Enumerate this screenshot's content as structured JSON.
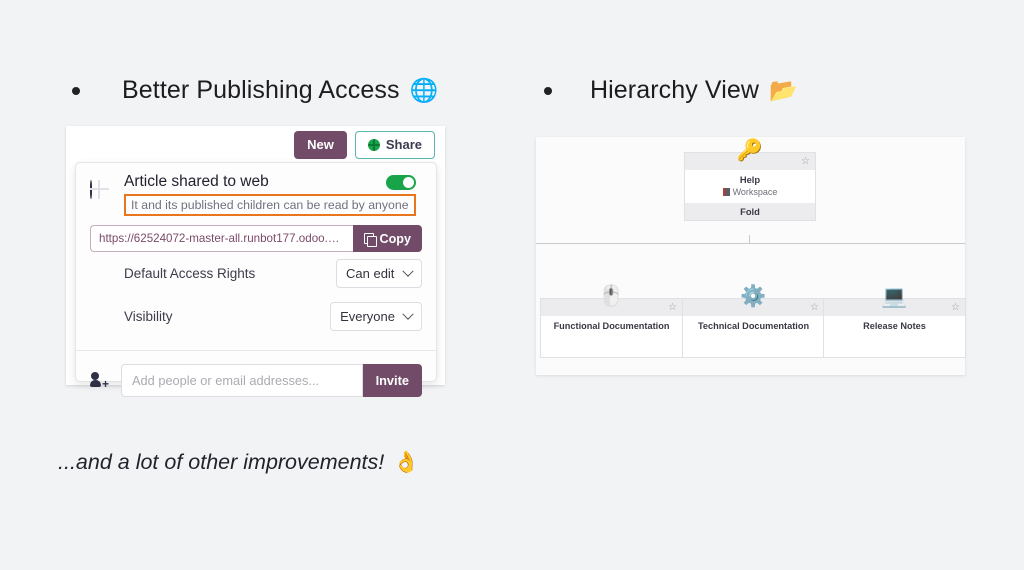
{
  "slide": {
    "background_color": "#f2f3f5",
    "sections": [
      {
        "bullet_label": "Better Publishing Access",
        "emoji": "🌐",
        "emoji_name": "globe-emoji"
      },
      {
        "bullet_label": "Hierarchy View",
        "emoji": "📂",
        "emoji_name": "open-folder-emoji"
      }
    ],
    "footer": {
      "text": "...and a lot of other improvements!",
      "emoji": "👌",
      "emoji_name": "ok-hand-emoji"
    }
  },
  "share_screenshot": {
    "toolbar": {
      "new_label": "New",
      "share_label": "Share",
      "new_color": "#714b67",
      "share_border_color": "#5ab5ae"
    },
    "panel": {
      "web_title": "Article shared to web",
      "web_subtitle": "It and its published children can be read by anyone",
      "highlight_color": "#e8761f",
      "toggle_state": "on",
      "toggle_color": "#19a44a",
      "url_value": "https://62524072-master-all.runbot177.odoo.com/k...",
      "copy_label": "Copy",
      "options": [
        {
          "label": "Default Access Rights",
          "value": "Can edit",
          "icon": "building-icon"
        },
        {
          "label": "Visibility",
          "value": "Everyone",
          "icon": "eye-icon"
        }
      ],
      "invite_placeholder": "Add people or email addresses...",
      "invite_label": "Invite"
    }
  },
  "hierarchy_screenshot": {
    "root": {
      "title": "Help",
      "subtitle": "Workspace",
      "footer": "Fold",
      "emoji": "🔑",
      "emoji_name": "key-emoji",
      "star": "☆"
    },
    "children": [
      {
        "title": "Functional Documentation",
        "emoji": "🖱️",
        "emoji_name": "computer-mouse-emoji",
        "star": "☆"
      },
      {
        "title": "Technical Documentation",
        "emoji": "⚙️",
        "emoji_name": "gear-emoji",
        "star": "☆"
      },
      {
        "title": "Release Notes",
        "emoji": "💻",
        "emoji_name": "laptop-emoji",
        "star": "☆"
      }
    ]
  }
}
